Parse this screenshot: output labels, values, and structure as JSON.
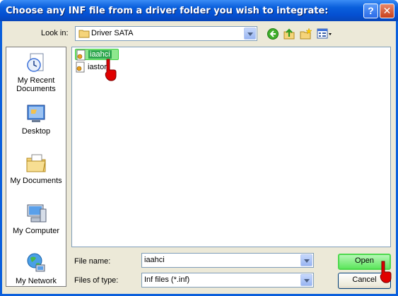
{
  "window": {
    "title": "Choose any INF file from a driver folder you wish to integrate:",
    "help_glyph": "?",
    "close_glyph": "✕"
  },
  "lookin": {
    "label": "Look in:",
    "value": "Driver SATA"
  },
  "toolbar": {
    "icons": [
      "back-icon",
      "up-one-level-icon",
      "create-new-folder-icon",
      "view-menu-icon"
    ]
  },
  "places": [
    {
      "label": "My Recent Documents",
      "line1": "My Recent",
      "line2": "Documents",
      "icon": "recent-documents-icon"
    },
    {
      "label": "Desktop",
      "icon": "desktop-icon"
    },
    {
      "label": "My Documents",
      "icon": "my-documents-icon"
    },
    {
      "label": "My Computer",
      "icon": "my-computer-icon"
    },
    {
      "label": "My Network",
      "icon": "my-network-icon"
    }
  ],
  "files": [
    {
      "name": "iaahci",
      "selected": true,
      "icon": "inf-file-icon"
    },
    {
      "name": "iastor",
      "selected": false,
      "icon": "inf-file-icon"
    }
  ],
  "filename": {
    "label": "File name:",
    "value": "iaahci"
  },
  "filetype": {
    "label": "Files of type:",
    "value": "Inf files (*.inf)"
  },
  "buttons": {
    "open": "Open",
    "cancel": "Cancel"
  },
  "colors": {
    "titlebar": "#0a5fdc",
    "dialog_bg": "#ece9d8",
    "highlight_green": "#5ee65e"
  }
}
